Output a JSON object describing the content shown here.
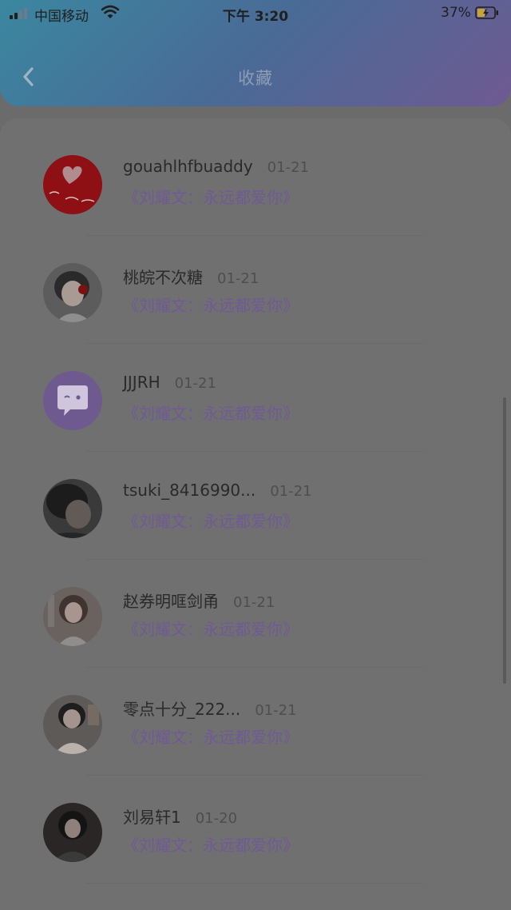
{
  "status_bar": {
    "carrier": "中国移动",
    "time": "下午 3:20",
    "battery": "37%",
    "signal_level": 2,
    "wifi_icon": "wifi-icon",
    "battery_icon": "battery-charging-icon"
  },
  "header": {
    "title": "收藏",
    "back_icon": "chevron-left-icon"
  },
  "colors": {
    "header_gradient": [
      "#3b87a0",
      "#6e5a92"
    ],
    "article_link": "#6f5a95"
  },
  "favorites": [
    {
      "username": "gouahlhfbuaddy",
      "date": "01-21",
      "article": "《刘耀文：永远都爱你》",
      "avatar": "red-heart-avatar"
    },
    {
      "username": "桃皖不次糖",
      "date": "01-21",
      "article": "《刘耀文：永远都爱你》",
      "avatar": "portrait-avatar"
    },
    {
      "username": "JJJRH",
      "date": "01-21",
      "article": "《刘耀文：永远都爱你》",
      "avatar": "default-chat-avatar"
    },
    {
      "username": "tsuki_8416990...",
      "date": "01-21",
      "article": "《刘耀文：永远都爱你》",
      "avatar": "portrait-avatar"
    },
    {
      "username": "赵券明哐剑甬",
      "date": "01-21",
      "article": "《刘耀文：永远都爱你》",
      "avatar": "portrait-avatar"
    },
    {
      "username": "零点十分_222...",
      "date": "01-21",
      "article": "《刘耀文：永远都爱你》",
      "avatar": "portrait-avatar"
    },
    {
      "username": "刘易轩1",
      "date": "01-20",
      "article": "《刘耀文：永远都爱你》",
      "avatar": "portrait-avatar"
    }
  ]
}
